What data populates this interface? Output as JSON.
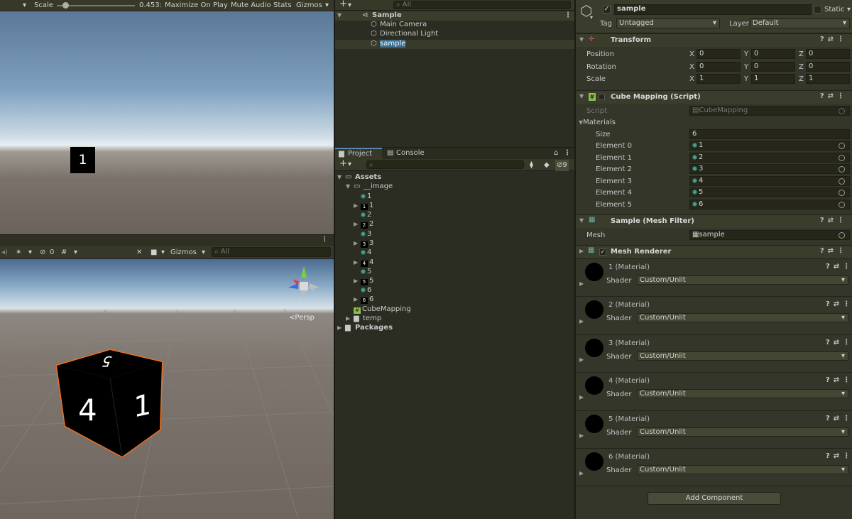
{
  "game_toolbar": {
    "scale_label": "Scale",
    "scale_value": "0.453:",
    "maximize": "Maximize On Play",
    "mute": "Mute Audio",
    "stats": "Stats",
    "gizmos": "Gizmos"
  },
  "game_view": {
    "cube_label": "1"
  },
  "scene_toolbar": {
    "hidden_count": "0",
    "gizmos": "Gizmos",
    "search_placeholder": "All"
  },
  "scene_view": {
    "persp_label": "Persp",
    "face_front": "4",
    "face_side": "1",
    "face_top": "5"
  },
  "hierarchy": {
    "search_placeholder": "All",
    "scene": "Sample",
    "items": [
      "Main Camera",
      "Directional Light",
      "sample"
    ]
  },
  "project": {
    "tab_project": "Project",
    "tab_console": "Console",
    "hidden_count": "9",
    "assets": "Assets",
    "image_folder": "__image",
    "image_items": [
      "1",
      "1",
      "2",
      "2",
      "3",
      "3",
      "4",
      "4",
      "5",
      "5",
      "6",
      "6"
    ],
    "cube_mapping": "CubeMapping",
    "temp": "temp",
    "packages": "Packages"
  },
  "inspector": {
    "name": "sample",
    "static_label": "Static",
    "tag_label": "Tag",
    "tag_value": "Untagged",
    "layer_label": "Layer",
    "layer_value": "Default",
    "transform": {
      "title": "Transform",
      "position_label": "Position",
      "rotation_label": "Rotation",
      "scale_label": "Scale",
      "x": "X",
      "y": "Y",
      "z": "Z",
      "position": [
        "0",
        "0",
        "0"
      ],
      "rotation": [
        "0",
        "0",
        "0"
      ],
      "scale": [
        "1",
        "1",
        "1"
      ]
    },
    "cube_mapping": {
      "title": "Cube Mapping (Script)",
      "script_label": "Script",
      "script_value": "CubeMapping",
      "materials_label": "Materials",
      "size_label": "Size",
      "size_value": "6",
      "elements": [
        {
          "label": "Element 0",
          "value": "1"
        },
        {
          "label": "Element 1",
          "value": "2"
        },
        {
          "label": "Element 2",
          "value": "3"
        },
        {
          "label": "Element 3",
          "value": "4"
        },
        {
          "label": "Element 4",
          "value": "5"
        },
        {
          "label": "Element 5",
          "value": "6"
        }
      ]
    },
    "mesh_filter": {
      "title": "Sample (Mesh Filter)",
      "mesh_label": "Mesh",
      "mesh_value": "sample"
    },
    "mesh_renderer": {
      "title": "Mesh Renderer"
    },
    "materials": [
      {
        "name": "1 (Material)"
      },
      {
        "name": "2 (Material)"
      },
      {
        "name": "3 (Material)"
      },
      {
        "name": "4 (Material)"
      },
      {
        "name": "5 (Material)"
      },
      {
        "name": "6 (Material)"
      }
    ],
    "shader_label": "Shader",
    "shader_value": "Custom/Unlit",
    "add_component": "Add Component"
  }
}
